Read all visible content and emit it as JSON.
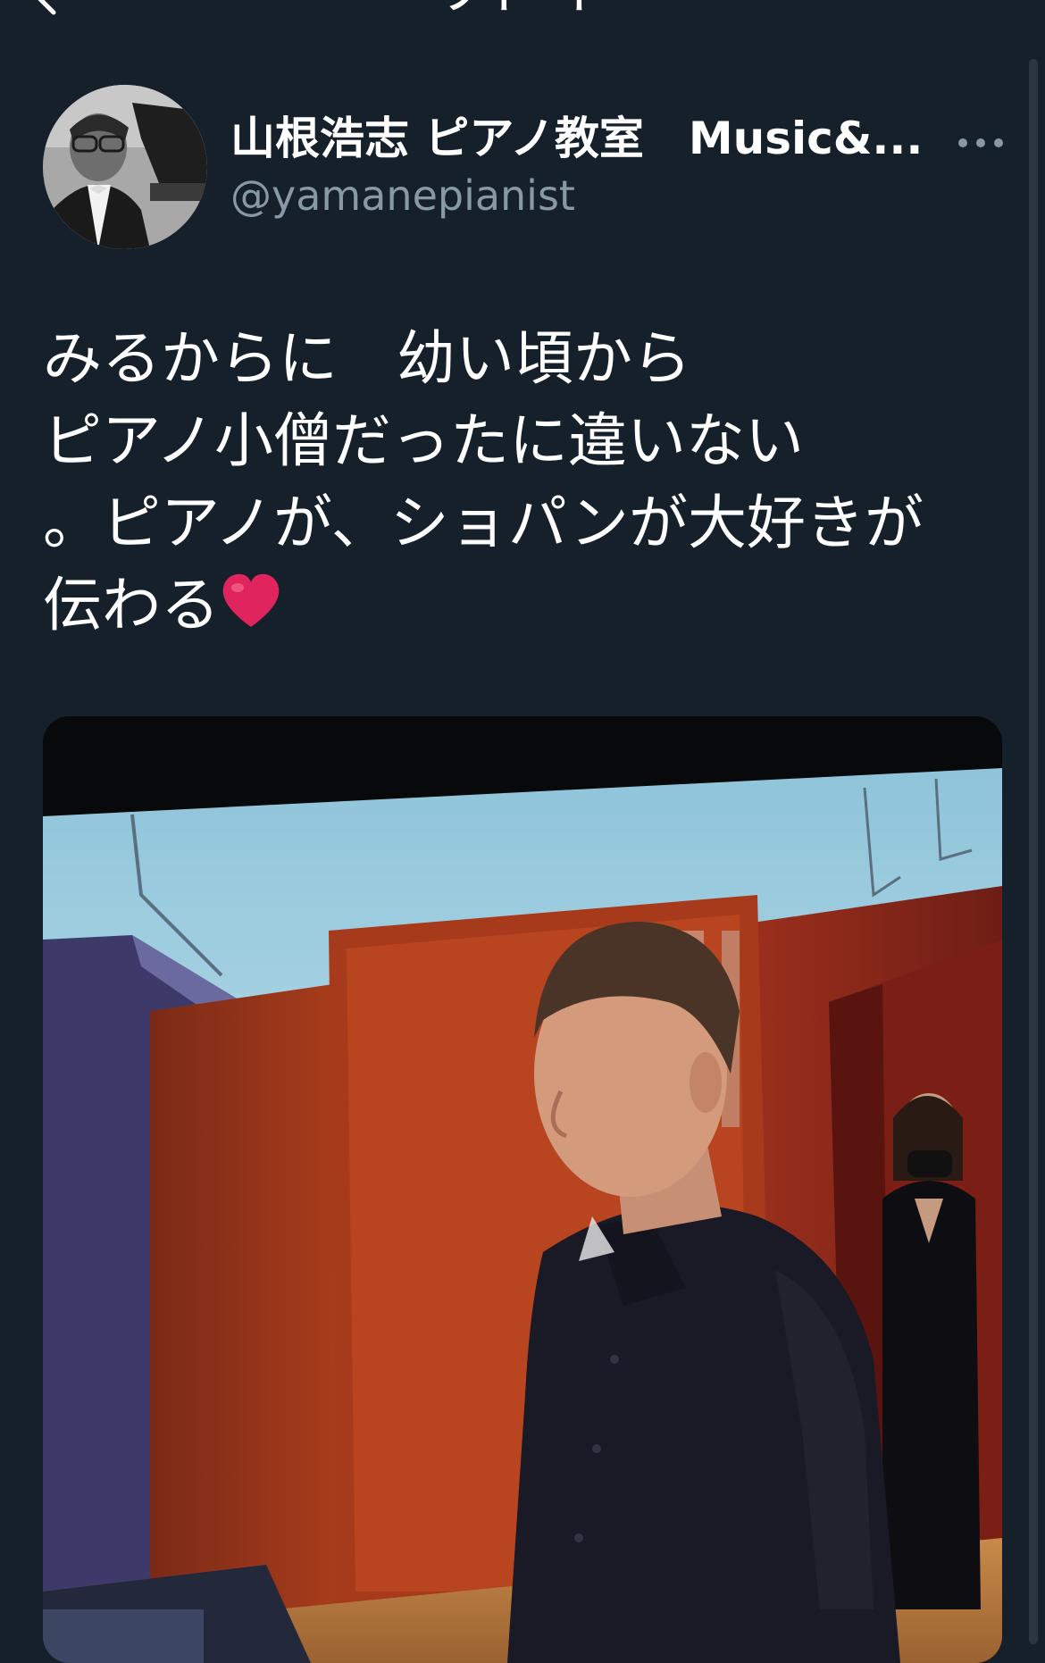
{
  "topbar": {
    "title": "ツイート",
    "back_icon": "chevron-left-icon"
  },
  "tweet": {
    "author": {
      "name": "山根浩志 ピアノ教室　Music&...",
      "handle": "@yamanepianist",
      "avatar_icon": "avatar-photo"
    },
    "more_icon": "more-horizontal-icon",
    "text_lines": [
      "みるからに　幼い頃から",
      "ピアノ小僧だったに違いない",
      "。ピアノが、ショパンが大好きが",
      "伝わる"
    ],
    "text_emoji": "heart-icon",
    "media": {
      "type": "photo",
      "description_icon": "tweet-photo"
    }
  },
  "colors": {
    "background": "#15202b",
    "text_primary": "#ffffff",
    "text_secondary": "#8899a6",
    "heart": "#e0245e"
  }
}
